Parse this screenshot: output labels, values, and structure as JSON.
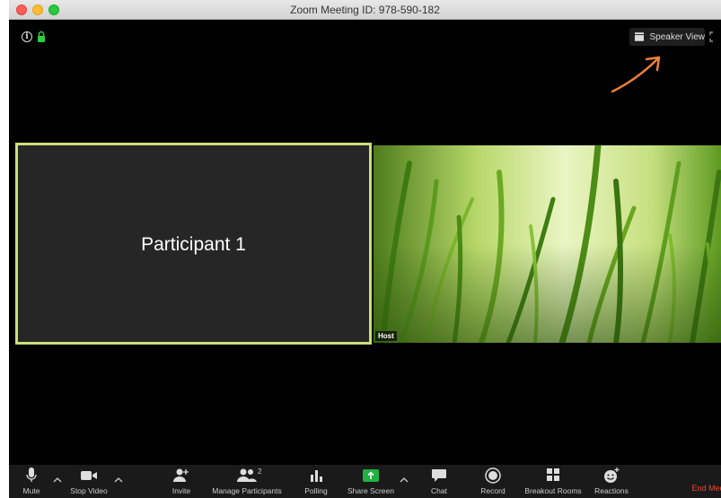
{
  "window": {
    "title": "Zoom Meeting ID: 978-590-182"
  },
  "top_right": {
    "speaker_view_label": "Speaker View"
  },
  "tiles": {
    "participant_1_name": "Participant 1",
    "host_label": "Host"
  },
  "toolbar": {
    "mute": "Mute",
    "stop_video": "Stop Video",
    "invite": "Invite",
    "manage_participants": "Manage Participants",
    "participant_count": "2",
    "polling": "Polling",
    "share_screen": "Share Screen",
    "chat": "Chat",
    "record": "Record",
    "breakout_rooms": "Breakout Rooms",
    "reactions": "Reactions",
    "end_meeting": "End Meeting"
  },
  "colors": {
    "active_speaker_border": "#c9e07a",
    "share_screen_green": "#1fb141",
    "end_meeting_red": "#e64b3b",
    "annotation_arrow": "#f07f3c"
  },
  "icons": [
    "info-icon",
    "lock-icon",
    "speaker-view-icon",
    "fullscreen-icon",
    "microphone-icon",
    "video-camera-icon",
    "add-user-icon",
    "participants-icon",
    "polling-icon",
    "share-screen-icon",
    "chat-icon",
    "record-icon",
    "breakout-rooms-icon",
    "reactions-icon"
  ]
}
